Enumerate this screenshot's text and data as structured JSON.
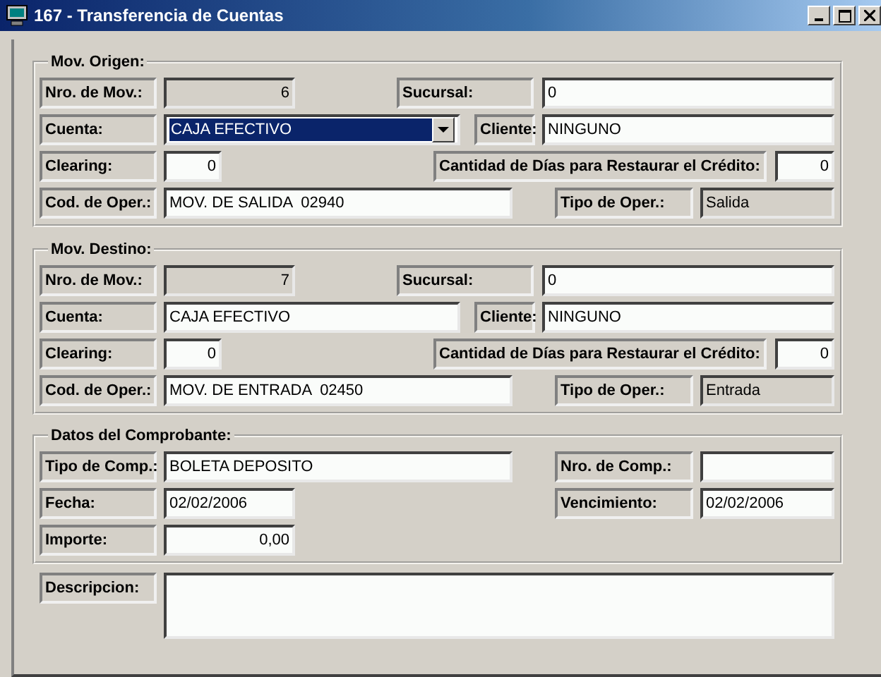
{
  "window": {
    "title": "167 - Transferencia de Cuentas"
  },
  "groups": [
    {
      "title": "Mov. Origen:",
      "rows": [
        [
          {
            "label": "Nro. de Mov.:",
            "value": "6",
            "kind": "readonly-number"
          },
          {
            "label": "Sucursal:",
            "value": "0",
            "kind": "text"
          }
        ],
        [
          {
            "label": "Cuenta:",
            "value": "CAJA EFECTIVO",
            "kind": "combo",
            "selected": true
          },
          {
            "label": "Cliente:",
            "value": "NINGUNO",
            "kind": "text"
          }
        ],
        [
          {
            "label": "Clearing:",
            "value": "0",
            "kind": "number"
          },
          {
            "label": "Cantidad de Días para Restaurar el Crédito:",
            "value": "0",
            "kind": "number"
          }
        ],
        [
          {
            "label": "Cod. de Oper.:",
            "value": "MOV. DE SALIDA  02940",
            "kind": "text"
          },
          {
            "label": "Tipo de Oper.:",
            "value": "Salida",
            "kind": "readonly-text"
          }
        ]
      ]
    },
    {
      "title": "Mov. Destino:",
      "rows": [
        [
          {
            "label": "Nro. de Mov.:",
            "value": "7",
            "kind": "readonly-number"
          },
          {
            "label": "Sucursal:",
            "value": "0",
            "kind": "text"
          }
        ],
        [
          {
            "label": "Cuenta:",
            "value": "CAJA EFECTIVO",
            "kind": "text"
          },
          {
            "label": "Cliente:",
            "value": "NINGUNO",
            "kind": "text"
          }
        ],
        [
          {
            "label": "Clearing:",
            "value": "0",
            "kind": "number"
          },
          {
            "label": "Cantidad de Días para Restaurar el Crédito:",
            "value": "0",
            "kind": "number"
          }
        ],
        [
          {
            "label": "Cod. de Oper.:",
            "value": "MOV. DE ENTRADA  02450",
            "kind": "text"
          },
          {
            "label": "Tipo de Oper.:",
            "value": "Entrada",
            "kind": "readonly-text"
          }
        ]
      ]
    },
    {
      "title": "Datos del Comprobante:",
      "rows": [
        [
          {
            "label": "Tipo de Comp.:",
            "value": "BOLETA DEPOSITO",
            "kind": "text"
          },
          {
            "label": "Nro. de Comp.:",
            "kind": "text"
          }
        ],
        [
          {
            "label": "Fecha:",
            "value": "02/02/2006",
            "kind": "text"
          },
          {
            "label": "Vencimiento:",
            "value": "02/02/2006",
            "kind": "text"
          }
        ],
        [
          {
            "label": "Importe:",
            "value": "0,00",
            "kind": "number"
          }
        ]
      ]
    }
  ],
  "description": {
    "label": "Descripcion:"
  }
}
